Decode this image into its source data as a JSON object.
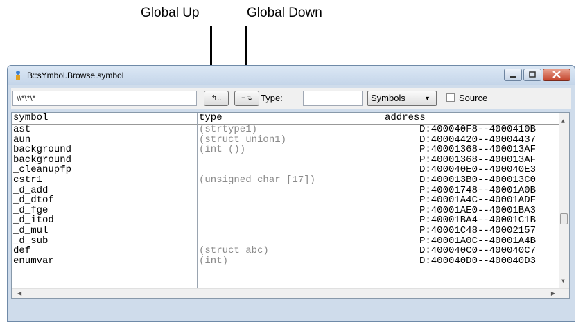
{
  "annotations": {
    "global_up": "Global Up",
    "global_down": "Global Down"
  },
  "window": {
    "title": "B::sYmbol.Browse.symbol"
  },
  "toolbar": {
    "search_value": "\\\\*\\*\\*",
    "global_up_glyph": "↰..",
    "global_down_glyph": "¬↴",
    "type_label": "Type:",
    "type_value": "",
    "mode_selected": "Symbols",
    "source_label": "Source",
    "source_checked": false
  },
  "table": {
    "headers": {
      "symbol": "symbol",
      "type": "type",
      "address": "address"
    },
    "rows": [
      {
        "symbol": "ast",
        "type": "(strtype1)",
        "address": "D:400040F8--4000410B"
      },
      {
        "symbol": "aun",
        "type": "(struct union1)",
        "address": "D:40004420--40004437"
      },
      {
        "symbol": "background",
        "type": "(int ())",
        "address": "P:40001368--400013AF"
      },
      {
        "symbol": "background",
        "type": "",
        "address": "P:40001368--400013AF"
      },
      {
        "symbol": "_cleanupfp",
        "type": "",
        "address": "D:400040E0--400040E3"
      },
      {
        "symbol": "cstr1",
        "type": "(unsigned char [17])",
        "address": "D:400013B0--400013C0"
      },
      {
        "symbol": "_d_add",
        "type": "",
        "address": "P:40001748--40001A0B"
      },
      {
        "symbol": "_d_dtof",
        "type": "",
        "address": "P:40001A4C--40001ADF"
      },
      {
        "symbol": "_d_fge",
        "type": "",
        "address": "P:40001AE0--40001BA3"
      },
      {
        "symbol": "_d_itod",
        "type": "",
        "address": "P:40001BA4--40001C1B"
      },
      {
        "symbol": "_d_mul",
        "type": "",
        "address": "P:40001C48--40002157"
      },
      {
        "symbol": "_d_sub",
        "type": "",
        "address": "P:40001A0C--40001A4B"
      },
      {
        "symbol": "def",
        "type": "(struct abc)",
        "address": "D:400040C0--400040C7"
      },
      {
        "symbol": "enumvar",
        "type": "(int)",
        "address": "D:400040D0--400040D3"
      }
    ]
  }
}
